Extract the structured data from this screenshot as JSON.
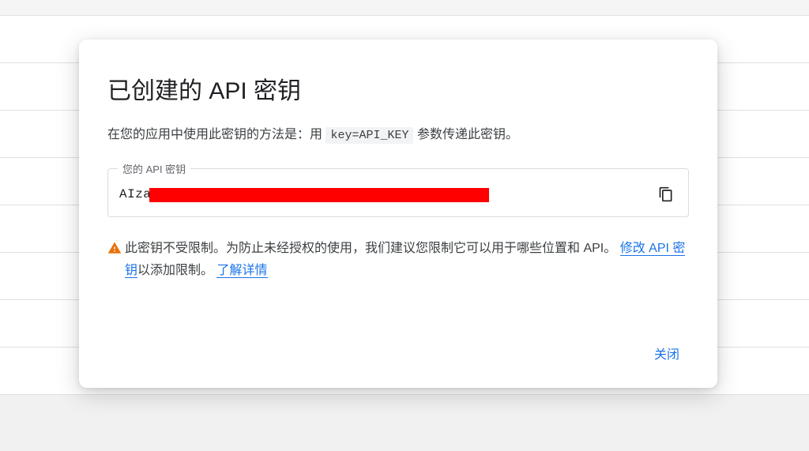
{
  "modal": {
    "title": "已创建的 API 密钥",
    "description_prefix": "在您的应用中使用此密钥的方法是：用 ",
    "description_code": "key=API_KEY",
    "description_suffix": " 参数传递此密钥。",
    "field_label": "您的 API 密钥",
    "api_key_visible_prefix": "AIza",
    "copy_aria": "copy",
    "warning_text_1": "此密钥不受限制。为防止未经授权的使用，我们建议您限制它可以用于哪些位置和 API。",
    "link_edit": "修改 API 密钥",
    "warning_text_2": "以添加限制。",
    "link_learn": "了解详情",
    "close_label": "关闭"
  }
}
